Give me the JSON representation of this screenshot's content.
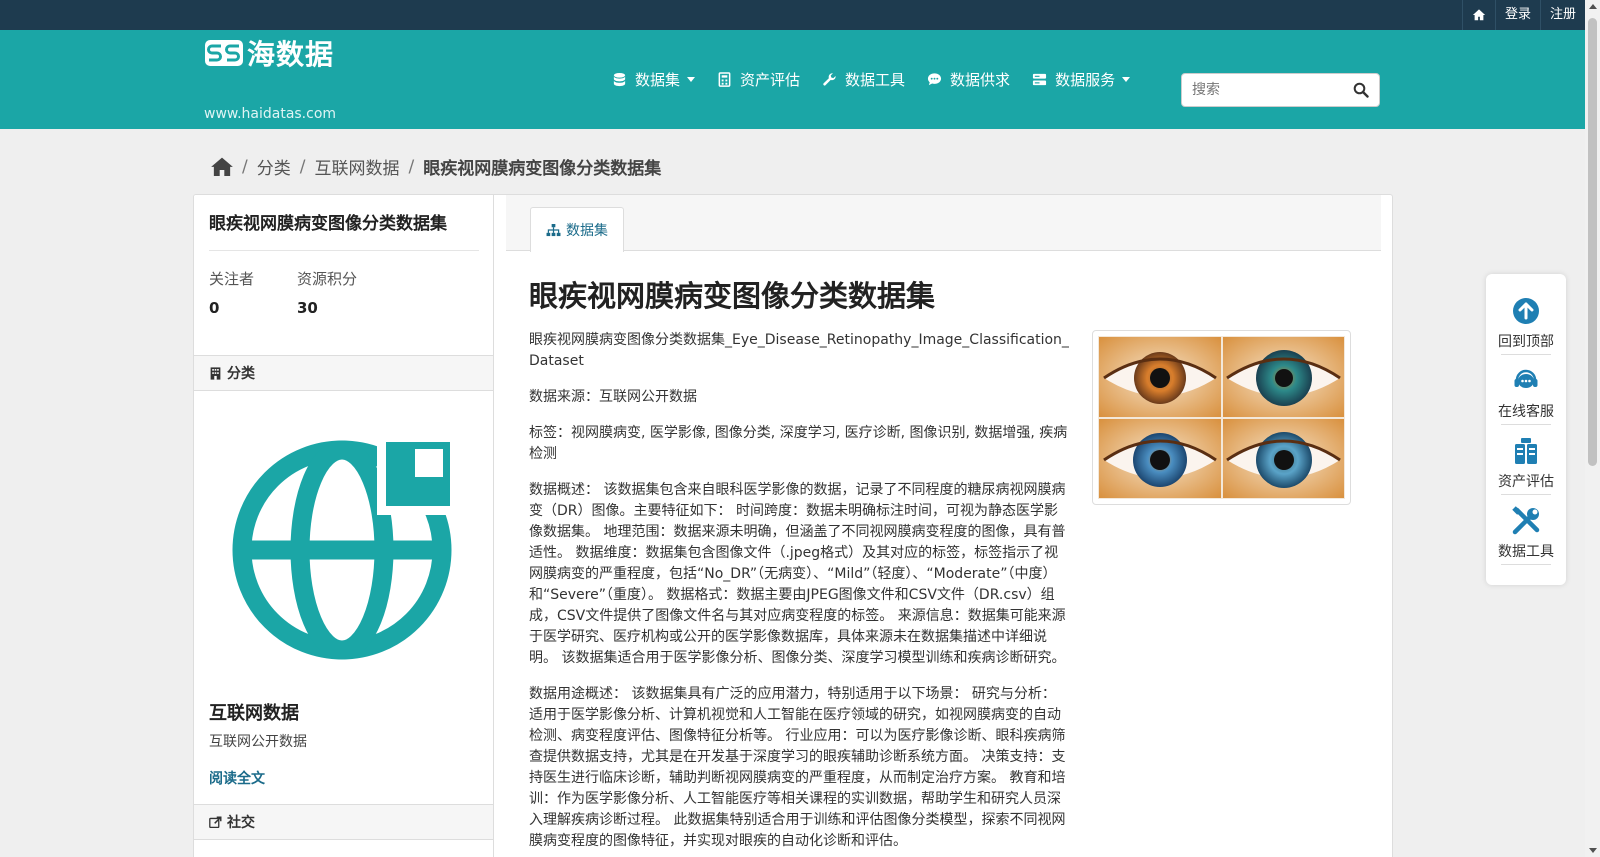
{
  "topbar": {
    "home_icon": "home-icon",
    "login": "登录",
    "register": "注册"
  },
  "logo": {
    "name": "海数据",
    "url": "www.haidatas.com"
  },
  "nav": [
    {
      "label": "数据集",
      "icon": "database-icon",
      "dropdown": true
    },
    {
      "label": "资产评估",
      "icon": "calculator-icon",
      "dropdown": false
    },
    {
      "label": "数据工具",
      "icon": "wrench-icon",
      "dropdown": false
    },
    {
      "label": "数据供求",
      "icon": "comment-icon",
      "dropdown": false
    },
    {
      "label": "数据服务",
      "icon": "server-icon",
      "dropdown": true
    }
  ],
  "search": {
    "placeholder": "搜索"
  },
  "breadcrumb": {
    "category": "分类",
    "sub": "互联网数据",
    "current": "眼疾视网膜病变图像分类数据集"
  },
  "sidebar": {
    "title": "眼疾视网膜病变图像分类数据集",
    "stats": [
      {
        "label": "关注者",
        "value": "0"
      },
      {
        "label": "资源积分",
        "value": "30"
      }
    ],
    "category_heading": "分类",
    "org_name": "互联网数据",
    "org_desc": "互联网公开数据",
    "read_more": "阅读全文",
    "social_heading": "社交"
  },
  "main": {
    "tab_label": "数据集",
    "title": "眼疾视网膜病变图像分类数据集",
    "paragraphs": [
      "眼疾视网膜病变图像分类数据集_Eye_Disease_Retinopathy_Image_Classification_Dataset",
      "数据来源：互联网公开数据",
      "标签：视网膜病变, 医学影像, 图像分类, 深度学习, 医疗诊断, 图像识别, 数据增强, 疾病检测",
      "数据概述： 该数据集包含来自眼科医学影像的数据，记录了不同程度的糖尿病视网膜病变（DR）图像。主要特征如下： 时间跨度：数据未明确标注时间，可视为静态医学影像数据集。 地理范围：数据来源未明确，但涵盖了不同视网膜病变程度的图像，具有普适性。 数据维度：数据集包含图像文件（.jpeg格式）及其对应的标签，标签指示了视网膜病变的严重程度，包括“No_DR”（无病变）、“Mild”（轻度）、“Moderate”（中度）和“Severe”（重度）。 数据格式：数据主要由JPEG图像文件和CSV文件（DR.csv）组成，CSV文件提供了图像文件名与其对应病变程度的标签。 来源信息：数据集可能来源于医学研究、医疗机构或公开的医学影像数据库，具体来源未在数据集描述中详细说明。 该数据集适合用于医学影像分析、图像分类、深度学习模型训练和疾病诊断研究。",
      "数据用途概述： 该数据集具有广泛的应用潜力，特别适用于以下场景： 研究与分析：适用于医学影像分析、计算机视觉和人工智能在医疗领域的研究，如视网膜病变的自动检测、病变程度评估、图像特征分析等。 行业应用：可以为医疗影像诊断、眼科疾病筛查提供数据支持，尤其是在开发基于深度学习的眼疾辅助诊断系统方面。 决策支持：支持医生进行临床诊断，辅助判断视网膜病变的严重程度，从而制定治疗方案。 教育和培训：作为医学影像分析、人工智能医疗等相关课程的实训数据，帮助学生和研究人员深入理解疾病诊断过程。 此数据集特别适合用于训练和评估图像分类模型，探索不同视网膜病变程度的图像特征，并实现对眼疾的自动化诊断和评估。"
    ],
    "thumbnail": "eye-images-thumbnail"
  },
  "float_panel": [
    {
      "label": "回到顶部",
      "icon": "arrow-up-circle-icon"
    },
    {
      "label": "在线客服",
      "icon": "headset-icon"
    },
    {
      "label": "资产评估",
      "icon": "assessment-icon"
    },
    {
      "label": "数据工具",
      "icon": "tools-icon"
    }
  ],
  "colors": {
    "teal": "#1ba6a6",
    "dark": "#1e3b4f",
    "link": "#1b6b8a",
    "icon_blue": "#1f7fb3"
  }
}
